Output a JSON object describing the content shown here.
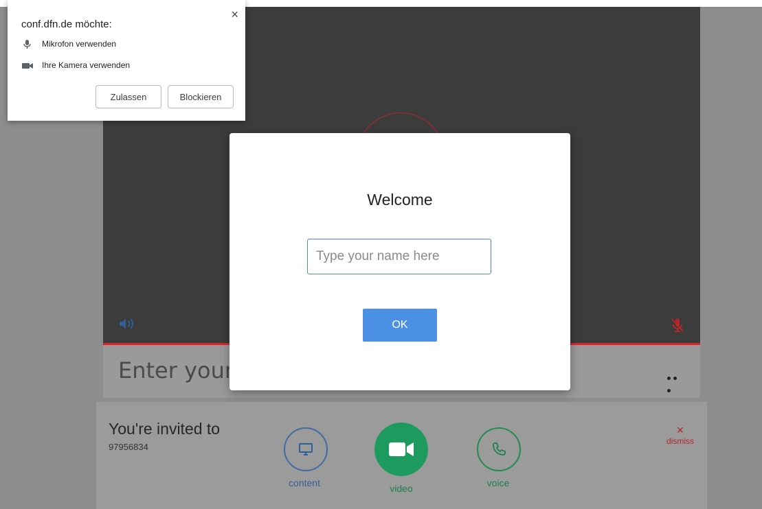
{
  "permission_popup": {
    "title": "conf.dfn.de möchte:",
    "close_symbol": "×",
    "items": [
      {
        "icon": "microphone-icon",
        "label": "Mikrofon verwenden"
      },
      {
        "icon": "camera-icon",
        "label": "Ihre Kamera verwenden"
      }
    ],
    "allow_label": "Zulassen",
    "block_label": "Blockieren"
  },
  "welcome_dialog": {
    "title": "Welcome",
    "name_placeholder": "Type your name here",
    "ok_label": "OK"
  },
  "name_bar": {
    "placeholder": "Enter your n"
  },
  "invite": {
    "title": "You're invited to",
    "number": "97956834",
    "content_label": "content",
    "video_label": "video",
    "voice_label": "voice",
    "dismiss_symbol": "×",
    "dismiss_label": "dismiss"
  },
  "colors": {
    "accent_blue": "#4b90e2",
    "alert_red": "#e0242a",
    "video_green": "#1d9b5f"
  }
}
